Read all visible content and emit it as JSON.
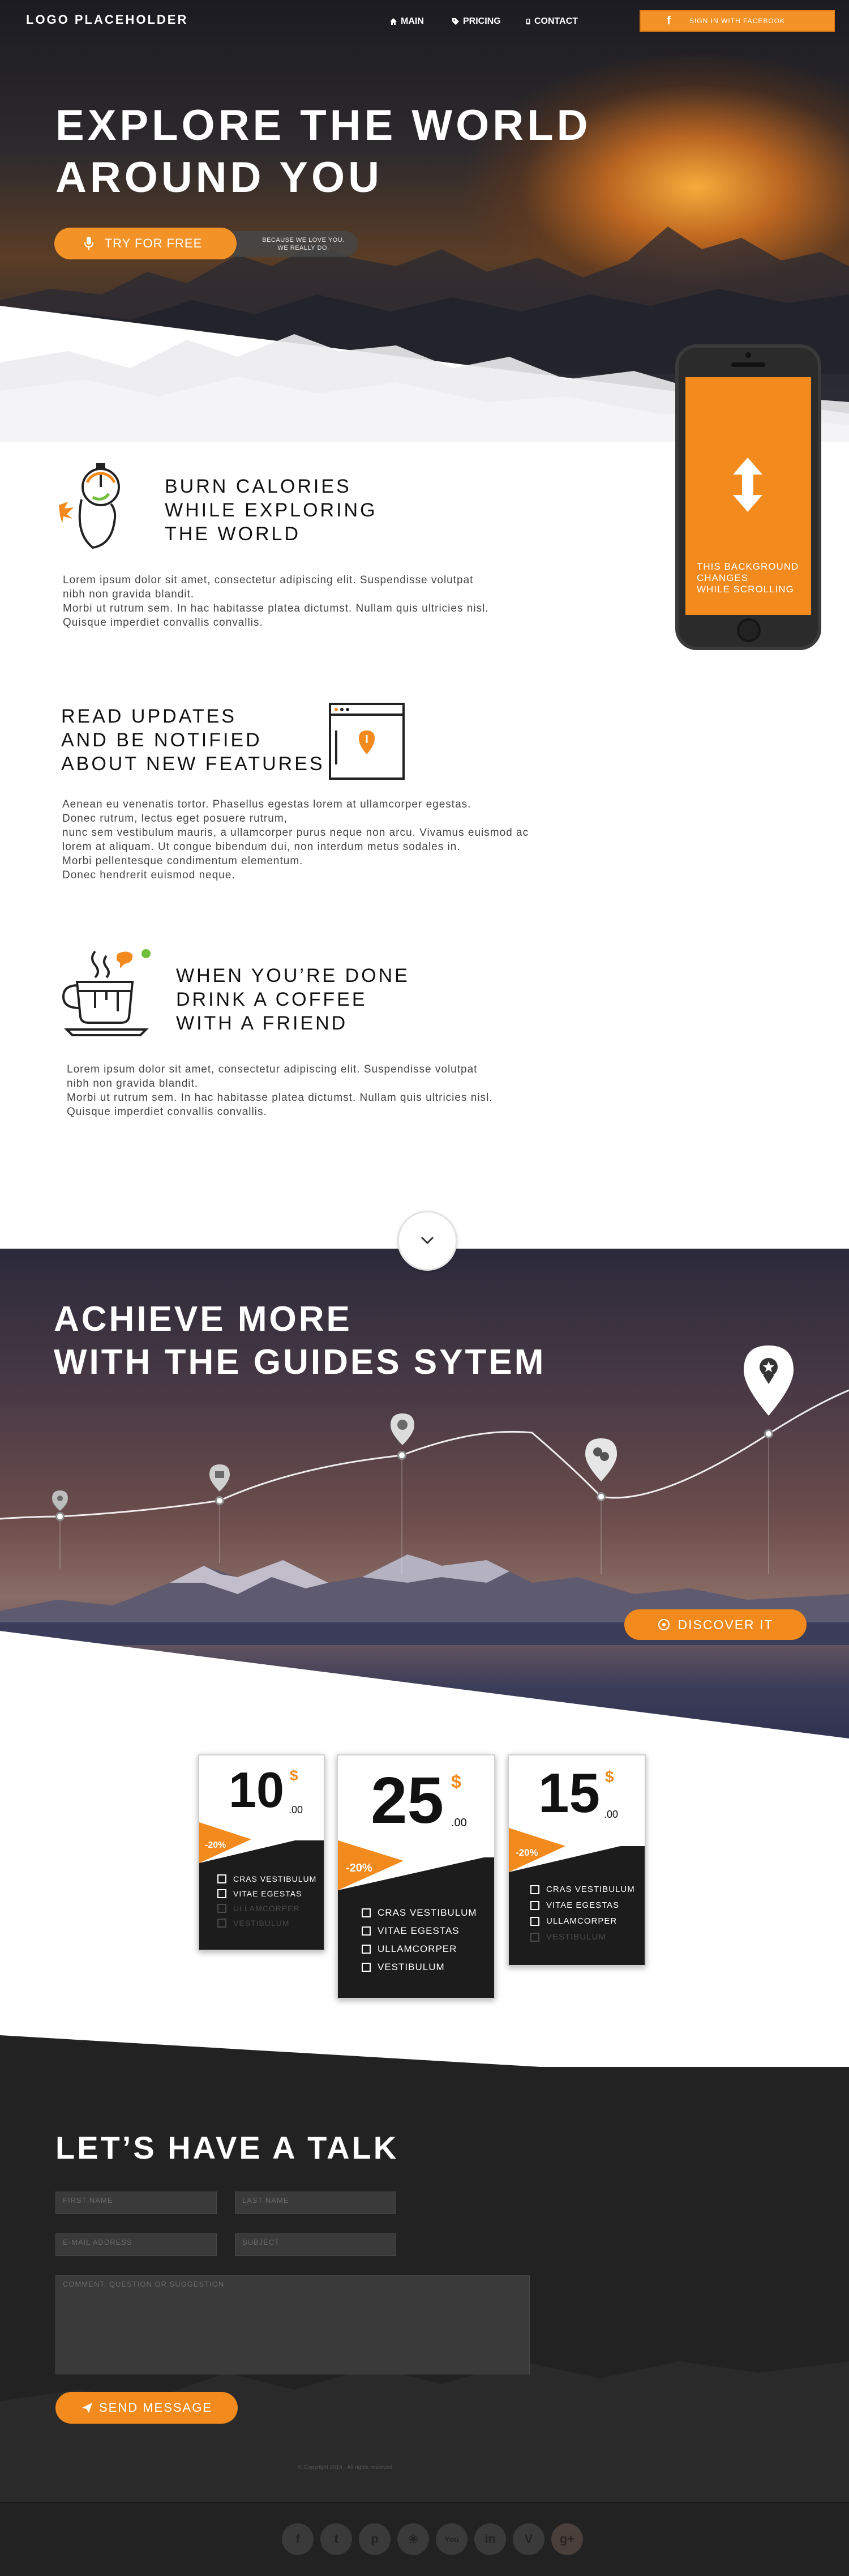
{
  "header": {
    "logo": "LOGO PLACEHOLDER",
    "nav": [
      {
        "icon": "home-icon",
        "label": "MAIN"
      },
      {
        "icon": "tag-icon",
        "label": "PRICING"
      },
      {
        "icon": "phone-icon",
        "label": "CONTACT"
      }
    ],
    "facebook_icon": "f",
    "facebook_label": "SIGN IN WITH FACEBOOK"
  },
  "hero": {
    "title_line1": "EXPLORE THE WORLD",
    "title_line2": "AROUND YOU",
    "cta_label": "TRY FOR FREE",
    "cta_note_line1": "BECAUSE WE LOVE YOU.",
    "cta_note_line2": "WE REALLY DO."
  },
  "features": [
    {
      "title_line1": "BURN CALORIES",
      "title_line2": "WHILE EXPLORING",
      "title_line3": "THE WORLD",
      "text_line1": "Lorem ipsum dolor sit amet, consectetur adipiscing elit. Suspendisse volutpat",
      "text_line2": "nibh non gravida blandit.",
      "text_line3": "Morbi ut rutrum sem. In hac habitasse platea dictumst. Nullam quis ultricies nisl.",
      "text_line4": "Quisque imperdiet convallis convallis."
    },
    {
      "title_line1": "READ UPDATES",
      "title_line2": "AND BE NOTIFIED",
      "title_line3": "ABOUT NEW FEATURES",
      "text_line1": "Aenean eu venenatis tortor. Phasellus egestas lorem at ullamcorper egestas.",
      "text_line2": "Donec rutrum, lectus eget posuere rutrum,",
      "text_line3": "nunc sem vestibulum mauris, a ullamcorper purus neque non arcu. Vivamus euismod ac",
      "text_line4": "lorem at aliquam. Ut congue bibendum dui, non interdum metus sodales in.",
      "text_line5": "Morbi pellentesque condimentum elementum.",
      "text_line6": "Donec hendrerit euismod neque."
    },
    {
      "title_line1": "WHEN YOU’RE DONE",
      "title_line2": "DRINK A COFFEE",
      "title_line3": "WITH A FRIEND",
      "text_line1": "Lorem ipsum dolor sit amet, consectetur adipiscing elit. Suspendisse volutpat",
      "text_line2": "nibh non gravida blandit.",
      "text_line3": "Morbi ut rutrum sem. In hac habitasse platea dictumst. Nullam quis ultricies nisl.",
      "text_line4": "Quisque imperdiet convallis convallis."
    }
  ],
  "phone": {
    "screen_line1": "THIS BACKGROUND",
    "screen_line2": "CHANGES",
    "screen_line3": "WHILE SCROLLING"
  },
  "guides": {
    "title_line1": "ACHIEVE MORE",
    "title_line2": "WITH THE GUIDES SYTEM",
    "discover_label": "DISCOVER IT"
  },
  "pricing": [
    {
      "price": "10",
      "currency": "$",
      "cents": ".00",
      "discount": "-20%",
      "features": [
        {
          "label": "CRAS VESTIBULUM",
          "active": true
        },
        {
          "label": "VITAE EGESTAS",
          "active": true
        },
        {
          "label": "ULLAMCORPER",
          "active": false
        },
        {
          "label": "VESTIBULUM",
          "active": false
        }
      ]
    },
    {
      "price": "25",
      "currency": "$",
      "cents": ".00",
      "discount": "-20%",
      "features": [
        {
          "label": "CRAS VESTIBULUM",
          "active": true
        },
        {
          "label": "VITAE EGESTAS",
          "active": true
        },
        {
          "label": "ULLAMCORPER",
          "active": true
        },
        {
          "label": "VESTIBULUM",
          "active": true
        }
      ]
    },
    {
      "price": "15",
      "currency": "$",
      "cents": ".00",
      "discount": "-20%",
      "features": [
        {
          "label": "CRAS VESTIBULUM",
          "active": true
        },
        {
          "label": "VITAE EGESTAS",
          "active": true
        },
        {
          "label": "ULLAMCORPER",
          "active": true
        },
        {
          "label": "VESTIBULUM",
          "active": false
        }
      ]
    }
  ],
  "contact": {
    "title": "LET’S HAVE A TALK",
    "first_name_placeholder": "FIRST NAME",
    "last_name_placeholder": "LAST NAME",
    "email_placeholder": "E-MAIL ADDRESS",
    "subject_placeholder": "SUBJECT",
    "message_placeholder": "COMMENT, QUESTION OR SUGGESTION",
    "send_label": "SEND MESSAGE",
    "copyright": "© Copyright 2014 · All rights reserved"
  },
  "social": [
    {
      "icon": "facebook-icon",
      "glyph": "f"
    },
    {
      "icon": "tumblr-icon",
      "glyph": "t"
    },
    {
      "icon": "pinterest-icon",
      "glyph": "p"
    },
    {
      "icon": "twitter-icon",
      "glyph": "❀"
    },
    {
      "icon": "youtube-icon",
      "glyph": "You"
    },
    {
      "icon": "linkedin-icon",
      "glyph": "in"
    },
    {
      "icon": "vimeo-icon",
      "glyph": "V"
    },
    {
      "icon": "googleplus-icon",
      "glyph": "g+"
    }
  ],
  "colors": {
    "accent": "#f28a1d",
    "dark": "#222222",
    "white": "#ffffff"
  }
}
